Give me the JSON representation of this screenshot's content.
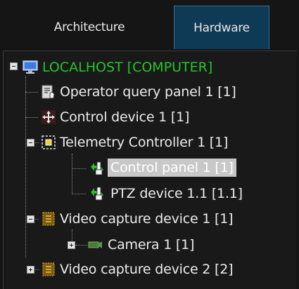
{
  "tabs": [
    {
      "label": "Architecture"
    },
    {
      "label": "Hardware"
    }
  ],
  "tree": [
    {
      "label": "LOCALHOST [COMPUTER]",
      "icon": "monitor-icon"
    },
    {
      "label": "Operator query panel 1 [1]",
      "icon": "operator-query-panel-icon"
    },
    {
      "label": "Control device 1 [1]",
      "icon": "move-arrows-icon"
    },
    {
      "label": "Telemetry Controller 1 [1]",
      "icon": "telemetry-controller-icon"
    },
    {
      "label": "Control panel 1 [1]",
      "icon": "joystick-icon"
    },
    {
      "label": "PTZ device 1.1 [1.1]",
      "icon": "joystick-icon"
    },
    {
      "label": "Video capture device 1 [1]",
      "icon": "capture-card-icon"
    },
    {
      "label": "Camera 1 [1]",
      "icon": "camera-icon"
    },
    {
      "label": "Video capture device 2 [2]",
      "icon": "capture-card-icon"
    }
  ],
  "colors": {
    "root_label": "#28c428",
    "active_tab": "#0f3a55"
  }
}
